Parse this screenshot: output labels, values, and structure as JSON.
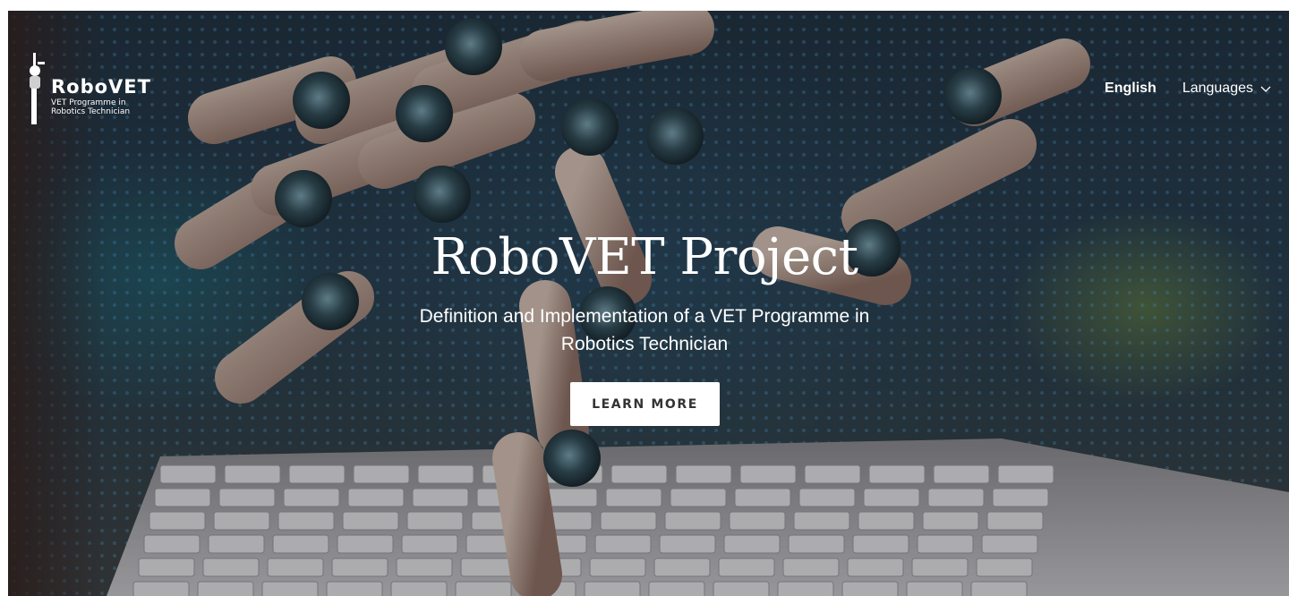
{
  "brand": {
    "name": "RoboVET",
    "tagline": "VET Programme in Robotics Technician"
  },
  "nav": {
    "active_language": "English",
    "languages_label": "Languages"
  },
  "hero": {
    "title": "RoboVET Project",
    "subtitle": "Definition and Implementation of a VET Programme in Robotics Technician",
    "cta_label": "LEARN MORE",
    "background_image": "robotic-hand-typing-on-laptop-keyboard"
  },
  "colors": {
    "text": "#ffffff",
    "button_bg": "#ffffff",
    "button_text": "#333333",
    "background_dark": "#1c2f3e"
  }
}
